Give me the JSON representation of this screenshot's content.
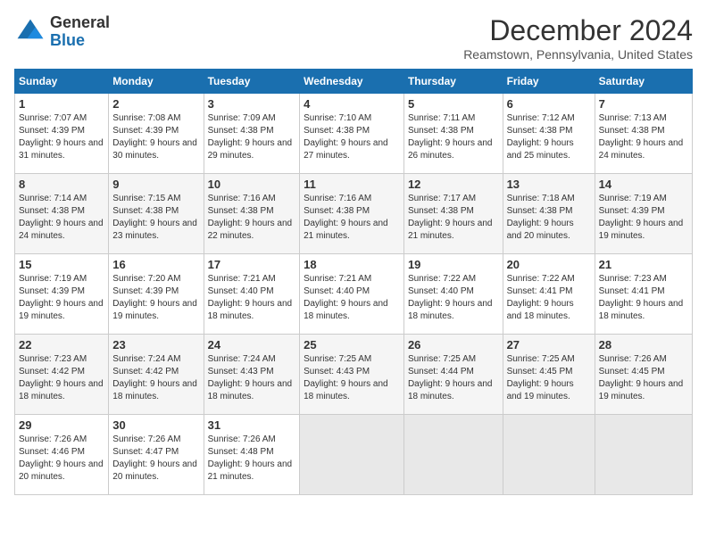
{
  "logo": {
    "text_general": "General",
    "text_blue": "Blue"
  },
  "title": "December 2024",
  "subtitle": "Reamstown, Pennsylvania, United States",
  "columns": [
    "Sunday",
    "Monday",
    "Tuesday",
    "Wednesday",
    "Thursday",
    "Friday",
    "Saturday"
  ],
  "weeks": [
    [
      {
        "day": "1",
        "sunrise": "7:07 AM",
        "sunset": "4:39 PM",
        "daylight": "9 hours and 31 minutes."
      },
      {
        "day": "2",
        "sunrise": "7:08 AM",
        "sunset": "4:39 PM",
        "daylight": "9 hours and 30 minutes."
      },
      {
        "day": "3",
        "sunrise": "7:09 AM",
        "sunset": "4:38 PM",
        "daylight": "9 hours and 29 minutes."
      },
      {
        "day": "4",
        "sunrise": "7:10 AM",
        "sunset": "4:38 PM",
        "daylight": "9 hours and 27 minutes."
      },
      {
        "day": "5",
        "sunrise": "7:11 AM",
        "sunset": "4:38 PM",
        "daylight": "9 hours and 26 minutes."
      },
      {
        "day": "6",
        "sunrise": "7:12 AM",
        "sunset": "4:38 PM",
        "daylight": "9 hours and 25 minutes."
      },
      {
        "day": "7",
        "sunrise": "7:13 AM",
        "sunset": "4:38 PM",
        "daylight": "9 hours and 24 minutes."
      }
    ],
    [
      {
        "day": "8",
        "sunrise": "7:14 AM",
        "sunset": "4:38 PM",
        "daylight": "9 hours and 24 minutes."
      },
      {
        "day": "9",
        "sunrise": "7:15 AM",
        "sunset": "4:38 PM",
        "daylight": "9 hours and 23 minutes."
      },
      {
        "day": "10",
        "sunrise": "7:16 AM",
        "sunset": "4:38 PM",
        "daylight": "9 hours and 22 minutes."
      },
      {
        "day": "11",
        "sunrise": "7:16 AM",
        "sunset": "4:38 PM",
        "daylight": "9 hours and 21 minutes."
      },
      {
        "day": "12",
        "sunrise": "7:17 AM",
        "sunset": "4:38 PM",
        "daylight": "9 hours and 21 minutes."
      },
      {
        "day": "13",
        "sunrise": "7:18 AM",
        "sunset": "4:38 PM",
        "daylight": "9 hours and 20 minutes."
      },
      {
        "day": "14",
        "sunrise": "7:19 AM",
        "sunset": "4:39 PM",
        "daylight": "9 hours and 19 minutes."
      }
    ],
    [
      {
        "day": "15",
        "sunrise": "7:19 AM",
        "sunset": "4:39 PM",
        "daylight": "9 hours and 19 minutes."
      },
      {
        "day": "16",
        "sunrise": "7:20 AM",
        "sunset": "4:39 PM",
        "daylight": "9 hours and 19 minutes."
      },
      {
        "day": "17",
        "sunrise": "7:21 AM",
        "sunset": "4:40 PM",
        "daylight": "9 hours and 18 minutes."
      },
      {
        "day": "18",
        "sunrise": "7:21 AM",
        "sunset": "4:40 PM",
        "daylight": "9 hours and 18 minutes."
      },
      {
        "day": "19",
        "sunrise": "7:22 AM",
        "sunset": "4:40 PM",
        "daylight": "9 hours and 18 minutes."
      },
      {
        "day": "20",
        "sunrise": "7:22 AM",
        "sunset": "4:41 PM",
        "daylight": "9 hours and 18 minutes."
      },
      {
        "day": "21",
        "sunrise": "7:23 AM",
        "sunset": "4:41 PM",
        "daylight": "9 hours and 18 minutes."
      }
    ],
    [
      {
        "day": "22",
        "sunrise": "7:23 AM",
        "sunset": "4:42 PM",
        "daylight": "9 hours and 18 minutes."
      },
      {
        "day": "23",
        "sunrise": "7:24 AM",
        "sunset": "4:42 PM",
        "daylight": "9 hours and 18 minutes."
      },
      {
        "day": "24",
        "sunrise": "7:24 AM",
        "sunset": "4:43 PM",
        "daylight": "9 hours and 18 minutes."
      },
      {
        "day": "25",
        "sunrise": "7:25 AM",
        "sunset": "4:43 PM",
        "daylight": "9 hours and 18 minutes."
      },
      {
        "day": "26",
        "sunrise": "7:25 AM",
        "sunset": "4:44 PM",
        "daylight": "9 hours and 18 minutes."
      },
      {
        "day": "27",
        "sunrise": "7:25 AM",
        "sunset": "4:45 PM",
        "daylight": "9 hours and 19 minutes."
      },
      {
        "day": "28",
        "sunrise": "7:26 AM",
        "sunset": "4:45 PM",
        "daylight": "9 hours and 19 minutes."
      }
    ],
    [
      {
        "day": "29",
        "sunrise": "7:26 AM",
        "sunset": "4:46 PM",
        "daylight": "9 hours and 20 minutes."
      },
      {
        "day": "30",
        "sunrise": "7:26 AM",
        "sunset": "4:47 PM",
        "daylight": "9 hours and 20 minutes."
      },
      {
        "day": "31",
        "sunrise": "7:26 AM",
        "sunset": "4:48 PM",
        "daylight": "9 hours and 21 minutes."
      },
      null,
      null,
      null,
      null
    ]
  ]
}
